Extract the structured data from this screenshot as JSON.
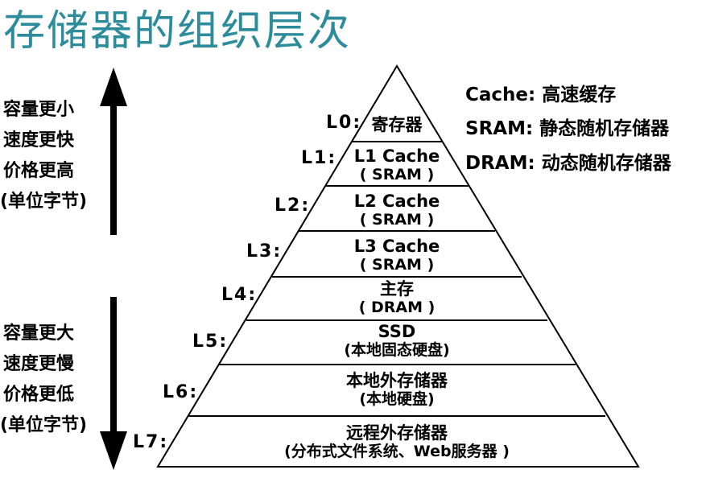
{
  "title": "存储器的组织层次",
  "upper_side": [
    "容量更小",
    "速度更快",
    "价格更高",
    "(单位字节)"
  ],
  "lower_side": [
    "容量更大",
    "速度更慢",
    "价格更低",
    "(单位字节)"
  ],
  "legend": [
    "Cache: 高速缓存",
    "SRAM: 静态随机存储器",
    "DRAM: 动态随机存储器"
  ],
  "levels": [
    {
      "label": "L0:",
      "name": "寄存器",
      "sub": ""
    },
    {
      "label": "L1:",
      "name": "L1 Cache",
      "sub": "( SRAM )"
    },
    {
      "label": "L2:",
      "name": "L2 Cache",
      "sub": "( SRAM )"
    },
    {
      "label": "L3:",
      "name": "L3 Cache",
      "sub": "( SRAM )"
    },
    {
      "label": "L4:",
      "name": "主存",
      "sub": "( DRAM )"
    },
    {
      "label": "L5:",
      "name": "SSD",
      "sub": "(本地固态硬盘)"
    },
    {
      "label": "L6:",
      "name": "本地外存储器",
      "sub": "(本地硬盘)"
    },
    {
      "label": "L7:",
      "name": "远程外存储器",
      "sub": "(分布式文件系统、Web服务器 )"
    }
  ],
  "colors": {
    "title": "#2c8c9c",
    "lines": "#000000"
  }
}
